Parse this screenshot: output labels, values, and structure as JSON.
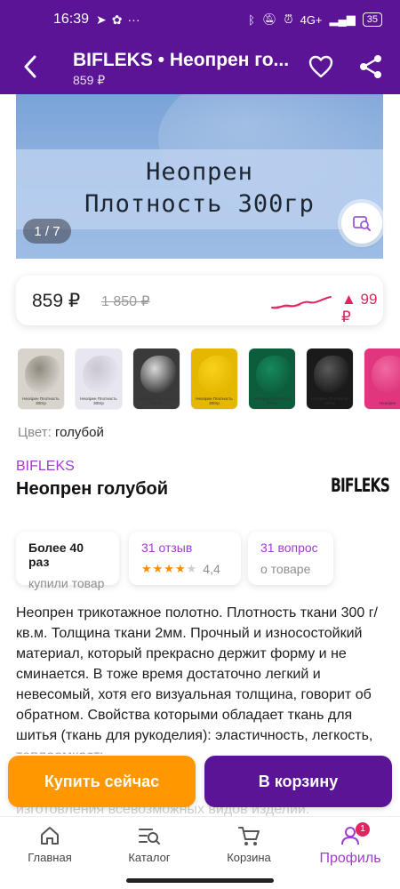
{
  "status_bar": {
    "time": "16:39",
    "network": "4G+",
    "battery": "35"
  },
  "app_bar": {
    "title": "BIFLEKS • Неопрен го...",
    "price": "859 ₽"
  },
  "gallery": {
    "image_text_line1": "Неопрен",
    "image_text_line2": "Плотность 300гр",
    "counter": "1 / 7"
  },
  "price": {
    "current": "859 ₽",
    "old": "1 850 ₽",
    "delta": "▲ 99 ₽"
  },
  "swatches": [
    {
      "name": "pattern",
      "color": "#d8d4cc",
      "fold": "#8f8a80",
      "label": "Неопрен Плотность 300гр"
    },
    {
      "name": "light-grey",
      "color": "#e8e6ee",
      "fold": "#c9c6d2",
      "label": "Неопрен Плотность 300гр"
    },
    {
      "name": "black-silver",
      "color": "#3a3a3a",
      "fold": "#d9d9d9",
      "label": "Неопрен Плотность 300гр"
    },
    {
      "name": "yellow",
      "color": "#e5b700",
      "fold": "#f7d21c",
      "label": "Неопрен Плотность 300гр"
    },
    {
      "name": "green",
      "color": "#0d5c3c",
      "fold": "#168a5a",
      "label": "Неопрен Плотность 300гр"
    },
    {
      "name": "black",
      "color": "#1a1a1a",
      "fold": "#5a5a5a",
      "label": "Неопрен Плотность 300гр"
    },
    {
      "name": "pink",
      "color": "#e0367d",
      "fold": "#f06a9f",
      "label": "Неопрен"
    }
  ],
  "color_info": {
    "label": "Цвет:",
    "value": "голубой"
  },
  "product": {
    "brand": "BIFLEKS",
    "title": "Неопрен голубой",
    "logo_text": "BIFLEKS"
  },
  "chips": {
    "bought_title": "Более 40 раз",
    "bought_sub": "купили товар",
    "reviews_title": "31 отзыв",
    "rating": "4,4",
    "rating_value": 4.4,
    "questions_title": "31 вопрос",
    "questions_sub": "о товаре"
  },
  "description": "Неопрен трикотажное полотно. Плотность ткани 300 г/кв.м. Толщина ткани 2мм. Прочный и износостойкий материал, который прекрасно держит форму и не сминается. В тоже время достаточно легкий и невесомый, хотя его визуальная толщина, говорит об обратном. Свойства которыми обладает ткань для шитья (ткань для рукоделия): эластичность, легкость, теплоемкость",
  "description_tail": "изготовления всевозможных видов изделий:",
  "cta": {
    "buy_now": "Купить сейчас",
    "add_to_cart": "В корзину"
  },
  "nav": {
    "home": "Главная",
    "catalog": "Каталог",
    "cart": "Корзина",
    "profile": "Профиль",
    "profile_badge": "1"
  },
  "colors": {
    "brand_purple": "#5b1496",
    "accent_purple": "#a23bd1",
    "orange": "#ff9800",
    "price_up": "#e0245e"
  }
}
